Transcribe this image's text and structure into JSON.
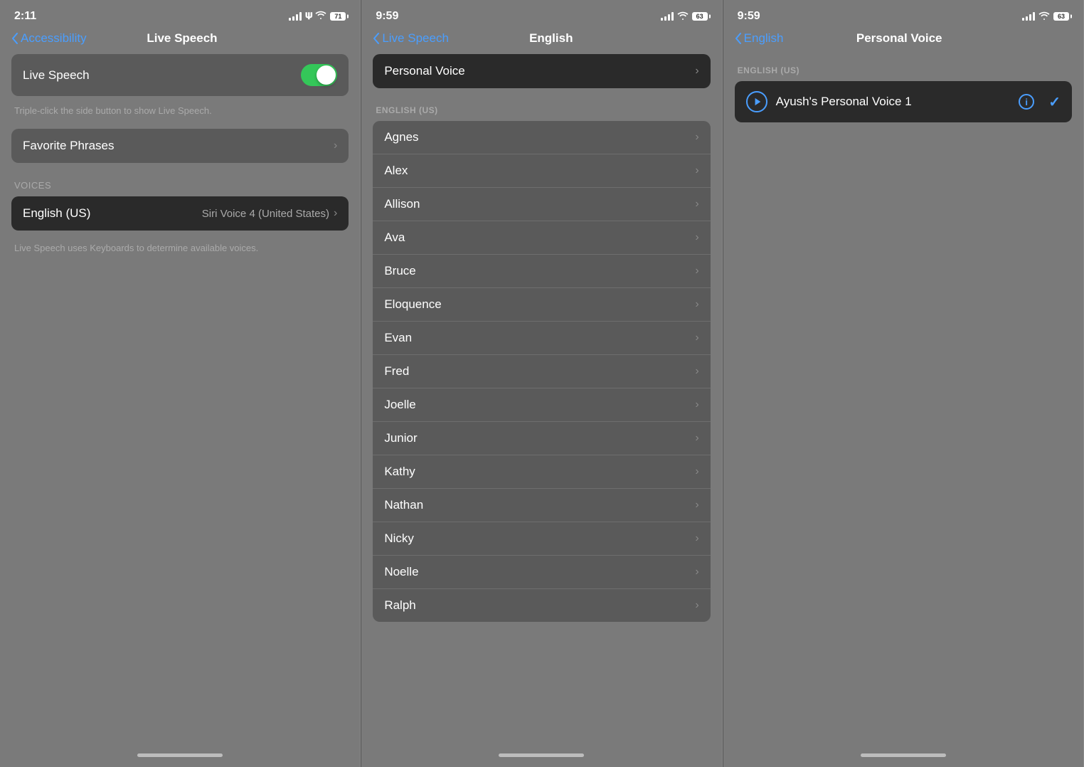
{
  "screen1": {
    "time": "2:11",
    "battery": "71",
    "back_label": "Accessibility",
    "title": "Live Speech",
    "toggle_label": "Live Speech",
    "toggle_hint": "Triple-click the side button to show Live Speech.",
    "favorite_phrases_label": "Favorite Phrases",
    "voices_section": "Voices",
    "english_us_label": "English (US)",
    "siri_voice_label": "Siri Voice 4 (United States)",
    "voices_helper": "Live Speech uses Keyboards to determine available voices."
  },
  "screen2": {
    "time": "9:59",
    "battery": "63",
    "back_label": "Live Speech",
    "title": "English",
    "personal_voice_label": "Personal Voice",
    "section_label": "English (US)",
    "voices": [
      "Agnes",
      "Alex",
      "Allison",
      "Ava",
      "Bruce",
      "Eloquence",
      "Evan",
      "Fred",
      "Joelle",
      "Junior",
      "Kathy",
      "Nathan",
      "Nicky",
      "Noelle",
      "Ralph"
    ]
  },
  "screen3": {
    "time": "9:59",
    "battery": "63",
    "back_label": "English",
    "title": "Personal Voice",
    "section_label": "English (US)",
    "voice_name": "Ayush's Personal Voice 1"
  }
}
